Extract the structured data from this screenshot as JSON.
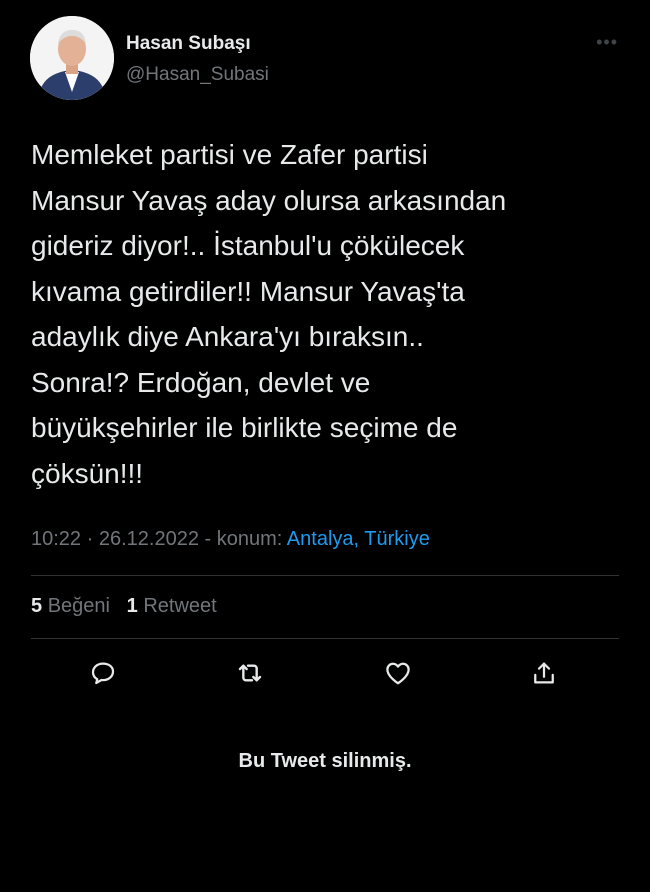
{
  "author": {
    "name": "Hasan Subaşı",
    "handle": "@Hasan_Subasi",
    "avatar_icon": "profile-photo"
  },
  "more_icon": "more-horizontal-icon",
  "tweet": {
    "text": "Memleket partisi ve Zafer partisi\nMansur Yavaş aday olursa arkasından\ngideriz diyor!.. İstanbul'u çökülecek\nkıvama getirdiler!! Mansur Yavaş'ta\nadaylık diye Ankara'yı bıraksın..\nSonra!? Erdoğan, devlet ve\nbüyükşehirler ile birlikte seçime de\nçöksün!!!",
    "time": "10:22",
    "separator": "·",
    "date": "26.12.2022",
    "location_prefix": "- konum:",
    "location": "Antalya, Türkiye"
  },
  "stats": {
    "likes_count": "5",
    "likes_label": "Beğeni",
    "retweets_count": "1",
    "retweets_label": "Retweet"
  },
  "actions": [
    {
      "icon": "reply-icon"
    },
    {
      "icon": "retweet-icon"
    },
    {
      "icon": "like-icon"
    },
    {
      "icon": "share-icon"
    }
  ],
  "deleted_notice": "Bu Tweet silinmiş.",
  "colors": {
    "background": "#000000",
    "text": "#e7e9ea",
    "secondary": "#71767b",
    "link": "#1d9bf0",
    "divider": "#2f3336"
  }
}
